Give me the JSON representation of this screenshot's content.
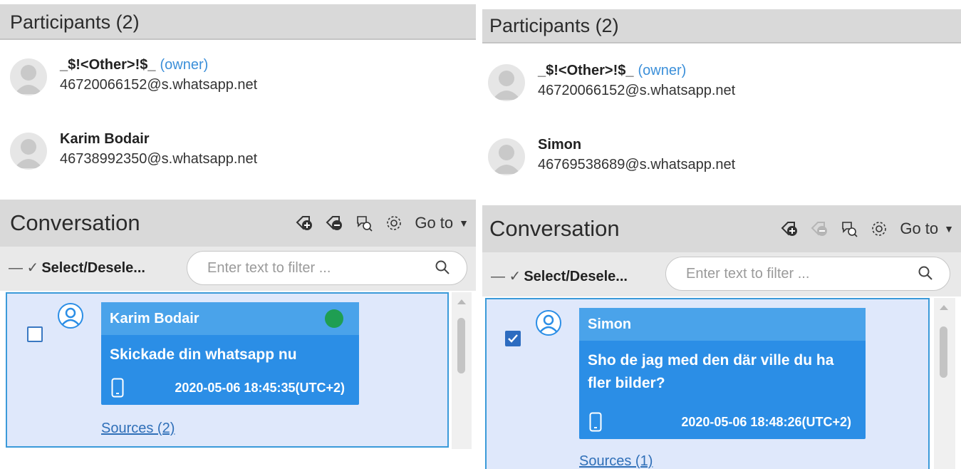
{
  "left": {
    "participants_title": "Participants (2)",
    "participants": [
      {
        "name": "_$!<Other>!$_",
        "role": "(owner)",
        "address": "46720066152@s.whatsapp.net"
      },
      {
        "name": "Karim Bodair",
        "role": "",
        "address": "46738992350@s.whatsapp.net"
      }
    ],
    "conversation_title": "Conversation",
    "goto_label": "Go to",
    "select_label": "Select/Desele...",
    "filter_placeholder": "Enter text to filter ...",
    "message": {
      "sender": "Karim Bodair",
      "text": "Skickade din whatsapp nu",
      "timestamp": "2020-05-06 18:45:35(UTC+2)",
      "sources": "Sources (2)",
      "checked": false,
      "status_color": "#1f9e52"
    }
  },
  "right": {
    "participants_title": "Participants (2)",
    "participants": [
      {
        "name": "_$!<Other>!$_",
        "role": "(owner)",
        "address": "46720066152@s.whatsapp.net"
      },
      {
        "name": "Simon",
        "role": "",
        "address": "46769538689@s.whatsapp.net"
      }
    ],
    "conversation_title": "Conversation",
    "goto_label": "Go to",
    "select_label": "Select/Desele...",
    "filter_placeholder": "Enter text to filter ...",
    "message": {
      "sender": "Simon",
      "text": "Sho de jag med den där ville du ha fler bilder?",
      "timestamp": "2020-05-06 18:48:26(UTC+2)",
      "sources": "Sources (1)",
      "checked": true
    }
  },
  "colors": {
    "accent": "#2b8ee6",
    "header_bg": "#d9d9d9",
    "link": "#3b8fd9"
  }
}
